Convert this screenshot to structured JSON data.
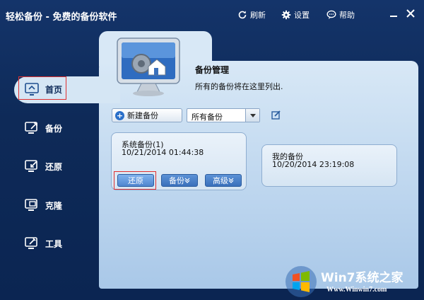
{
  "app": {
    "title": "轻松备份 - 免费的备份软件"
  },
  "titlebar": {
    "refresh_label": "刷新",
    "settings_label": "设置",
    "help_label": "帮助"
  },
  "sidebar": {
    "items": [
      {
        "label": "首页",
        "icon": "home-icon",
        "active": true
      },
      {
        "label": "备份",
        "icon": "backup-icon"
      },
      {
        "label": "还原",
        "icon": "restore-icon"
      },
      {
        "label": "克隆",
        "icon": "clone-icon"
      },
      {
        "label": "工具",
        "icon": "tools-icon"
      }
    ]
  },
  "main": {
    "title": "备份管理",
    "description": "所有的备份将在这里列出.",
    "new_backup_label": "新建备份",
    "filter": {
      "selected": "所有备份"
    },
    "backups": [
      {
        "name": "系统备份(1)",
        "date": "10/21/2014 01:44:38",
        "actions": {
          "restore": "还原",
          "backup": "备份",
          "advanced": "高级"
        }
      },
      {
        "name": "我的备份",
        "date": "10/20/2014 23:19:08"
      }
    ]
  },
  "watermark": {
    "text": "Win7系统之家",
    "url": "Www.Winwin7.com"
  },
  "colors": {
    "accent": "#2a6fc9",
    "highlight_border": "#e03030"
  }
}
